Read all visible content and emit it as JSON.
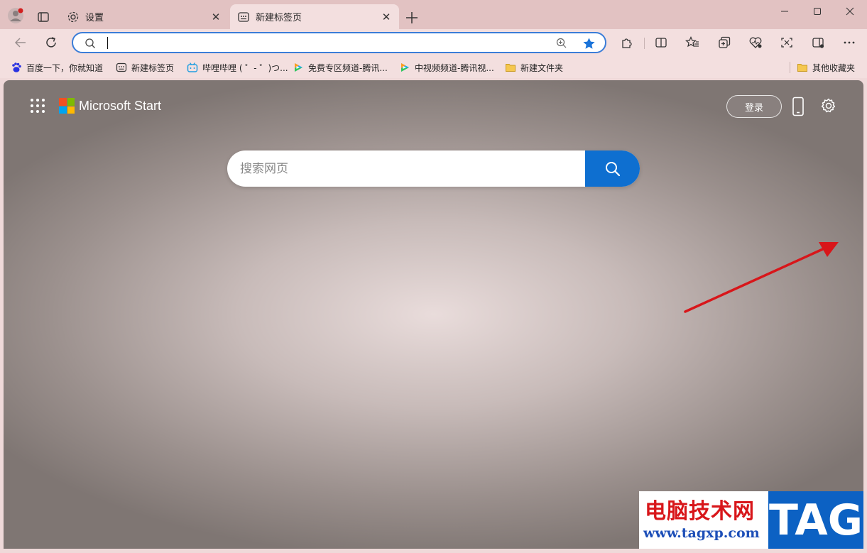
{
  "tabs": [
    {
      "label": "设置",
      "icon": "gear-icon",
      "active": false
    },
    {
      "label": "新建标签页",
      "icon": "new-tab-page-icon",
      "active": true
    }
  ],
  "window_controls": [
    "minimize",
    "maximize",
    "close"
  ],
  "address_bar": {
    "value": "",
    "placeholder": ""
  },
  "toolbar_icons": [
    "back-icon",
    "refresh-icon",
    "zoom-icon",
    "favorite-star-icon",
    "extensions-icon",
    "split-screen-icon",
    "favorites-icon",
    "collections-icon",
    "browser-essentials-icon",
    "screenshot-icon",
    "sidebar-icon",
    "more-icon"
  ],
  "bookmarks": [
    {
      "label": "百度一下，你就知道",
      "icon": "baidu-icon"
    },
    {
      "label": "新建标签页",
      "icon": "new-tab-page-icon"
    },
    {
      "label": "哔哩哔哩 ( ゜- ゜)つ...",
      "icon": "bilibili-icon"
    },
    {
      "label": "免费专区频道-腾讯...",
      "icon": "tencent-video-icon"
    },
    {
      "label": "中视频频道-腾讯视...",
      "icon": "tencent-video-icon"
    },
    {
      "label": "新建文件夹",
      "icon": "folder-icon"
    }
  ],
  "other_favorites": {
    "label": "其他收藏夹",
    "icon": "folder-icon"
  },
  "start_page": {
    "brand": "Microsoft Start",
    "signin_label": "登录",
    "search_placeholder": "搜索网页"
  },
  "watermark": {
    "title": "电脑技术网",
    "url": "www.tagxp.com",
    "tag": "TAG"
  },
  "colors": {
    "accent": "#0e6fd0",
    "tabstrip": "#e2c2c2",
    "toolbar": "#f3dfdf",
    "annotation_arrow": "#d8161a"
  }
}
